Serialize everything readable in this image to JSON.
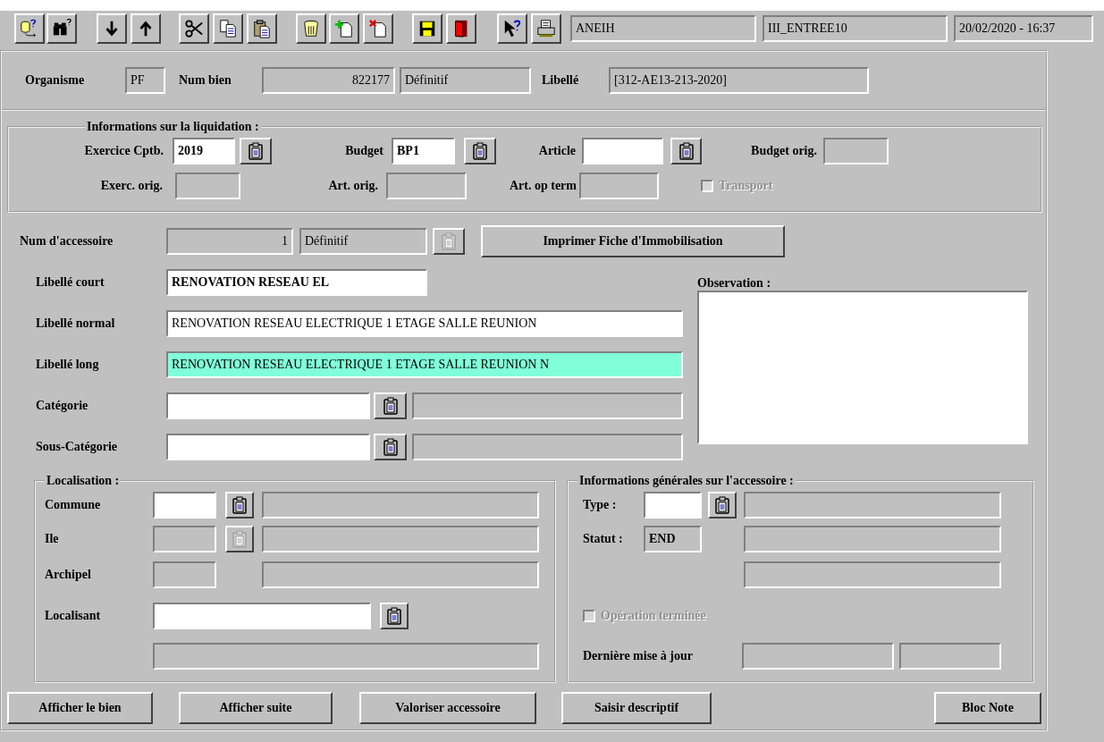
{
  "toolbar": {
    "fields": [
      {
        "value": "ANEIH"
      },
      {
        "value": "III_ENTREE10"
      },
      {
        "value": "20/02/2020 - 16:37"
      }
    ]
  },
  "header": {
    "organisme": {
      "label": "Organisme",
      "value": "PF",
      "disabled": true
    },
    "num_bien": {
      "label": "Num bien",
      "value": "822177",
      "status": "Définitif",
      "disabled": true
    },
    "libelle": {
      "label": "Libellé",
      "value": "[312-AE13-213-2020]",
      "disabled": true
    }
  },
  "liquidation": {
    "title": "Informations sur la liquidation :",
    "exercice": {
      "label": "Exercice Cptb.",
      "value": "2019",
      "disabled": false,
      "lookup_disabled": false
    },
    "budget": {
      "label": "Budget",
      "value": "BP1",
      "disabled": false,
      "lookup_disabled": false
    },
    "article": {
      "label": "Article",
      "disabled": false,
      "lookup_disabled": false
    },
    "budget_orig": {
      "label": "Budget orig.",
      "disabled": true
    },
    "exerc_orig": {
      "label": "Exerc. orig.",
      "disabled": true
    },
    "art_orig": {
      "label": "Art. orig.",
      "disabled": true
    },
    "art_op_term": {
      "label": "Art. op term",
      "disabled": true
    },
    "transport": {
      "label": "Transport",
      "checked": false,
      "disabled": true
    }
  },
  "accessoire": {
    "num": {
      "label": "Num d'accessoire",
      "value": "1",
      "status": "Définitif",
      "disabled": true,
      "lookup_disabled": true
    },
    "print_button": "Imprimer Fiche d'Immobilisation",
    "libelle_court": {
      "label": "Libellé court",
      "value": "RENOVATION RESEAU EL",
      "disabled": false,
      "highlighted": false
    },
    "libelle_normal": {
      "label": "Libellé normal",
      "value": "RENOVATION RESEAU ELECTRIQUE 1 ETAGE SALLE REUNION",
      "disabled": false,
      "highlighted": false
    },
    "libelle_long": {
      "label": "Libellé long",
      "value": "RENOVATION RESEAU ELECTRIQUE 1 ETAGE SALLE REUNION N",
      "disabled": false,
      "highlighted": true
    },
    "categorie": {
      "label": "Catégorie",
      "disabled": false,
      "lookup_disabled": false
    },
    "sous_categorie": {
      "label": "Sous-Catégorie",
      "disabled": false,
      "lookup_disabled": false
    },
    "observation": {
      "label": "Observation :"
    }
  },
  "localisation": {
    "title": "Localisation :",
    "commune": {
      "label": "Commune",
      "disabled": false,
      "lookup_disabled": false
    },
    "ile": {
      "label": "Ile",
      "disabled": true,
      "lookup_disabled": true
    },
    "archipel": {
      "label": "Archipel",
      "disabled": true
    },
    "localisant": {
      "label": "Localisant",
      "disabled": false,
      "lookup_disabled": false
    }
  },
  "infos": {
    "title": "Informations générales sur l'accessoire :",
    "type": {
      "label": "Type :",
      "disabled": false,
      "lookup_disabled": false
    },
    "statut": {
      "label": "Statut :",
      "value": "END",
      "disabled": true
    },
    "operation": {
      "label": "Opération terminée",
      "checked": false,
      "disabled": true
    },
    "derniere_maj": {
      "label": "Dernière mise à jour"
    }
  },
  "buttons": [
    "Afficher le bien",
    "Afficher suite",
    "Valoriser accessoire",
    "Saisir descriptif",
    "Bloc Note"
  ]
}
